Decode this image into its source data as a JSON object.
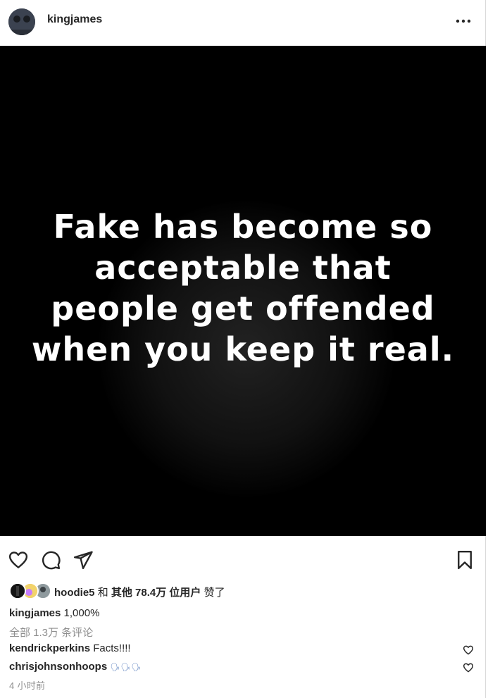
{
  "post": {
    "author": "kingjames",
    "image_text": "Fake has become so acceptable that people get offended when you keep it real."
  },
  "actions": {
    "like_icon": "heart-outline-icon",
    "comment_icon": "comment-bubble-icon",
    "share_icon": "paper-plane-icon",
    "save_icon": "bookmark-icon",
    "more_icon": "more-dots-icon"
  },
  "likes": {
    "first_user": "hoodie5",
    "and_text": "和",
    "others_bold": "其他 78.4万 位用户",
    "liked_text": "赞了"
  },
  "caption": {
    "username": "kingjames",
    "text": "1,000%"
  },
  "comments": {
    "view_all": "全部 1.3万 条评论",
    "items": [
      {
        "username": "kendrickperkins",
        "text": "Facts!!!!"
      },
      {
        "username": "chrisjohnsonhoops",
        "text": "🗣🗣🗣"
      }
    ]
  },
  "timestamp": "4 小时前",
  "colors": {
    "text": "#262626",
    "muted": "#8e8e8e",
    "image_bg": "#000000"
  }
}
